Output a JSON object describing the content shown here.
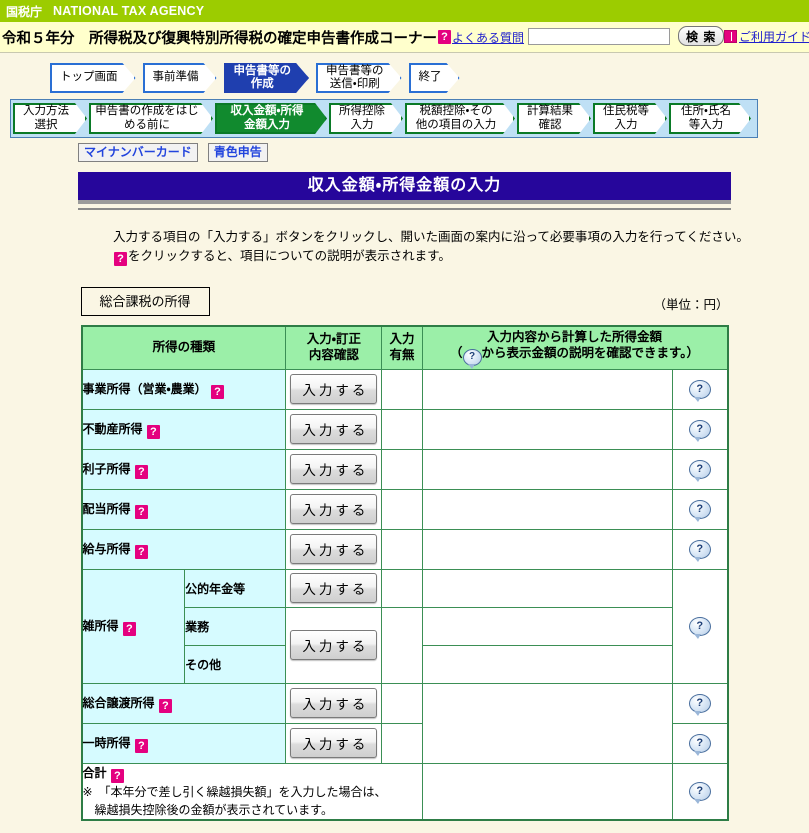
{
  "header": {
    "agency_jp": "国税庁",
    "agency_en": "NATIONAL TAX AGENCY",
    "site_title": "令和５年分　所得税及び復興特別所得税の確定申告書作成コーナー",
    "faq_link": "よくある質問",
    "faq_help_icon": "question-mark-icon",
    "search_value": "",
    "search_placeholder": "",
    "search_button": "検 索",
    "guide_link": "ご利用ガイド",
    "guide_icon": "book-icon"
  },
  "nav": {
    "primary_steps": [
      {
        "label": "トップ画面",
        "active": false
      },
      {
        "label": "事前準備",
        "active": false
      },
      {
        "label": "申告書等の\n作成",
        "active": true
      },
      {
        "label": "申告書等の\n送信・印刷",
        "active": false
      },
      {
        "label": "終了",
        "active": false
      }
    ],
    "secondary_steps": [
      {
        "label": "入力方法\n選択",
        "active": false
      },
      {
        "label": "申告書の作成をはじ\nめる前に",
        "active": false
      },
      {
        "label": "収入金額・所得\n金額入力",
        "active": true
      },
      {
        "label": "所得控除\n入力",
        "active": false
      },
      {
        "label": "税額控除・その\n他の項目の入力",
        "active": false
      },
      {
        "label": "計算結果\n確認",
        "active": false
      },
      {
        "label": "住民税等\n入力",
        "active": false
      },
      {
        "label": "住所・氏名\n等入力",
        "active": false
      }
    ],
    "badges": [
      "マイナンバーカード",
      "青色申告"
    ]
  },
  "page": {
    "heading": "収入金額・所得金額の入力",
    "instruction_line1": "入力する項目の「入力する」ボタンをクリックし、開いた画面の案内に沿って必要事項の入力を行ってください。",
    "instruction_line2_suffix": "をクリックすると、項目についての説明が表示されます。",
    "section_label": "総合課税の所得",
    "unit_label": "（単位：円）"
  },
  "table": {
    "headers": {
      "kind": "所得の種類",
      "entry": "入力・訂正\n内容確認",
      "has_entry": "入力\n有無",
      "amount_line1": "入力内容から計算した所得金額",
      "amount_line2_prefix": "（",
      "amount_line2_suffix": "から表示金額の説明を確認できます。）"
    },
    "button_label": "入力する",
    "rows": [
      {
        "name": "事業所得（営業・農業）",
        "help": true,
        "entry_flag": "",
        "amount": ""
      },
      {
        "name": "不動産所得",
        "help": true,
        "entry_flag": "",
        "amount": ""
      },
      {
        "name": "利子所得",
        "help": true,
        "entry_flag": "",
        "amount": ""
      },
      {
        "name": "配当所得",
        "help": true,
        "entry_flag": "",
        "amount": ""
      },
      {
        "name": "給与所得",
        "help": true,
        "entry_flag": "",
        "amount": ""
      }
    ],
    "misc": {
      "name": "雑所得",
      "help": true,
      "sub_rows": [
        {
          "name": "公的年金等",
          "entry_flag": "",
          "amount": ""
        },
        {
          "name": "業務",
          "entry_flag": "",
          "amount": ""
        },
        {
          "name": "その他",
          "entry_flag": "",
          "amount": ""
        }
      ]
    },
    "rows_after": [
      {
        "name": "総合譲渡所得",
        "help": true,
        "entry_flag": "",
        "amount": ""
      },
      {
        "name": "一時所得",
        "help": true,
        "entry_flag": "",
        "amount": ""
      }
    ],
    "total_row": {
      "label": "合計",
      "help": true,
      "note_line1": "※　「本年分で差し引く繰越損失額」を入力した場合は、",
      "note_line2": "繰越損失控除後の金額が表示されています。",
      "amount": ""
    }
  },
  "colors": {
    "agency_green": "#9CCC00",
    "title_yellow": "#FFFFCC",
    "page_bg": "#FAF6E4",
    "heading_blue": "#26069B",
    "step_blue": "#1F3FAF",
    "step_green": "#118A2E",
    "table_header_green": "#9BEFA8",
    "name_cell_cyan": "#D6FBFF",
    "help_magenta": "#E4007F",
    "link_blue": "#2222CC"
  }
}
